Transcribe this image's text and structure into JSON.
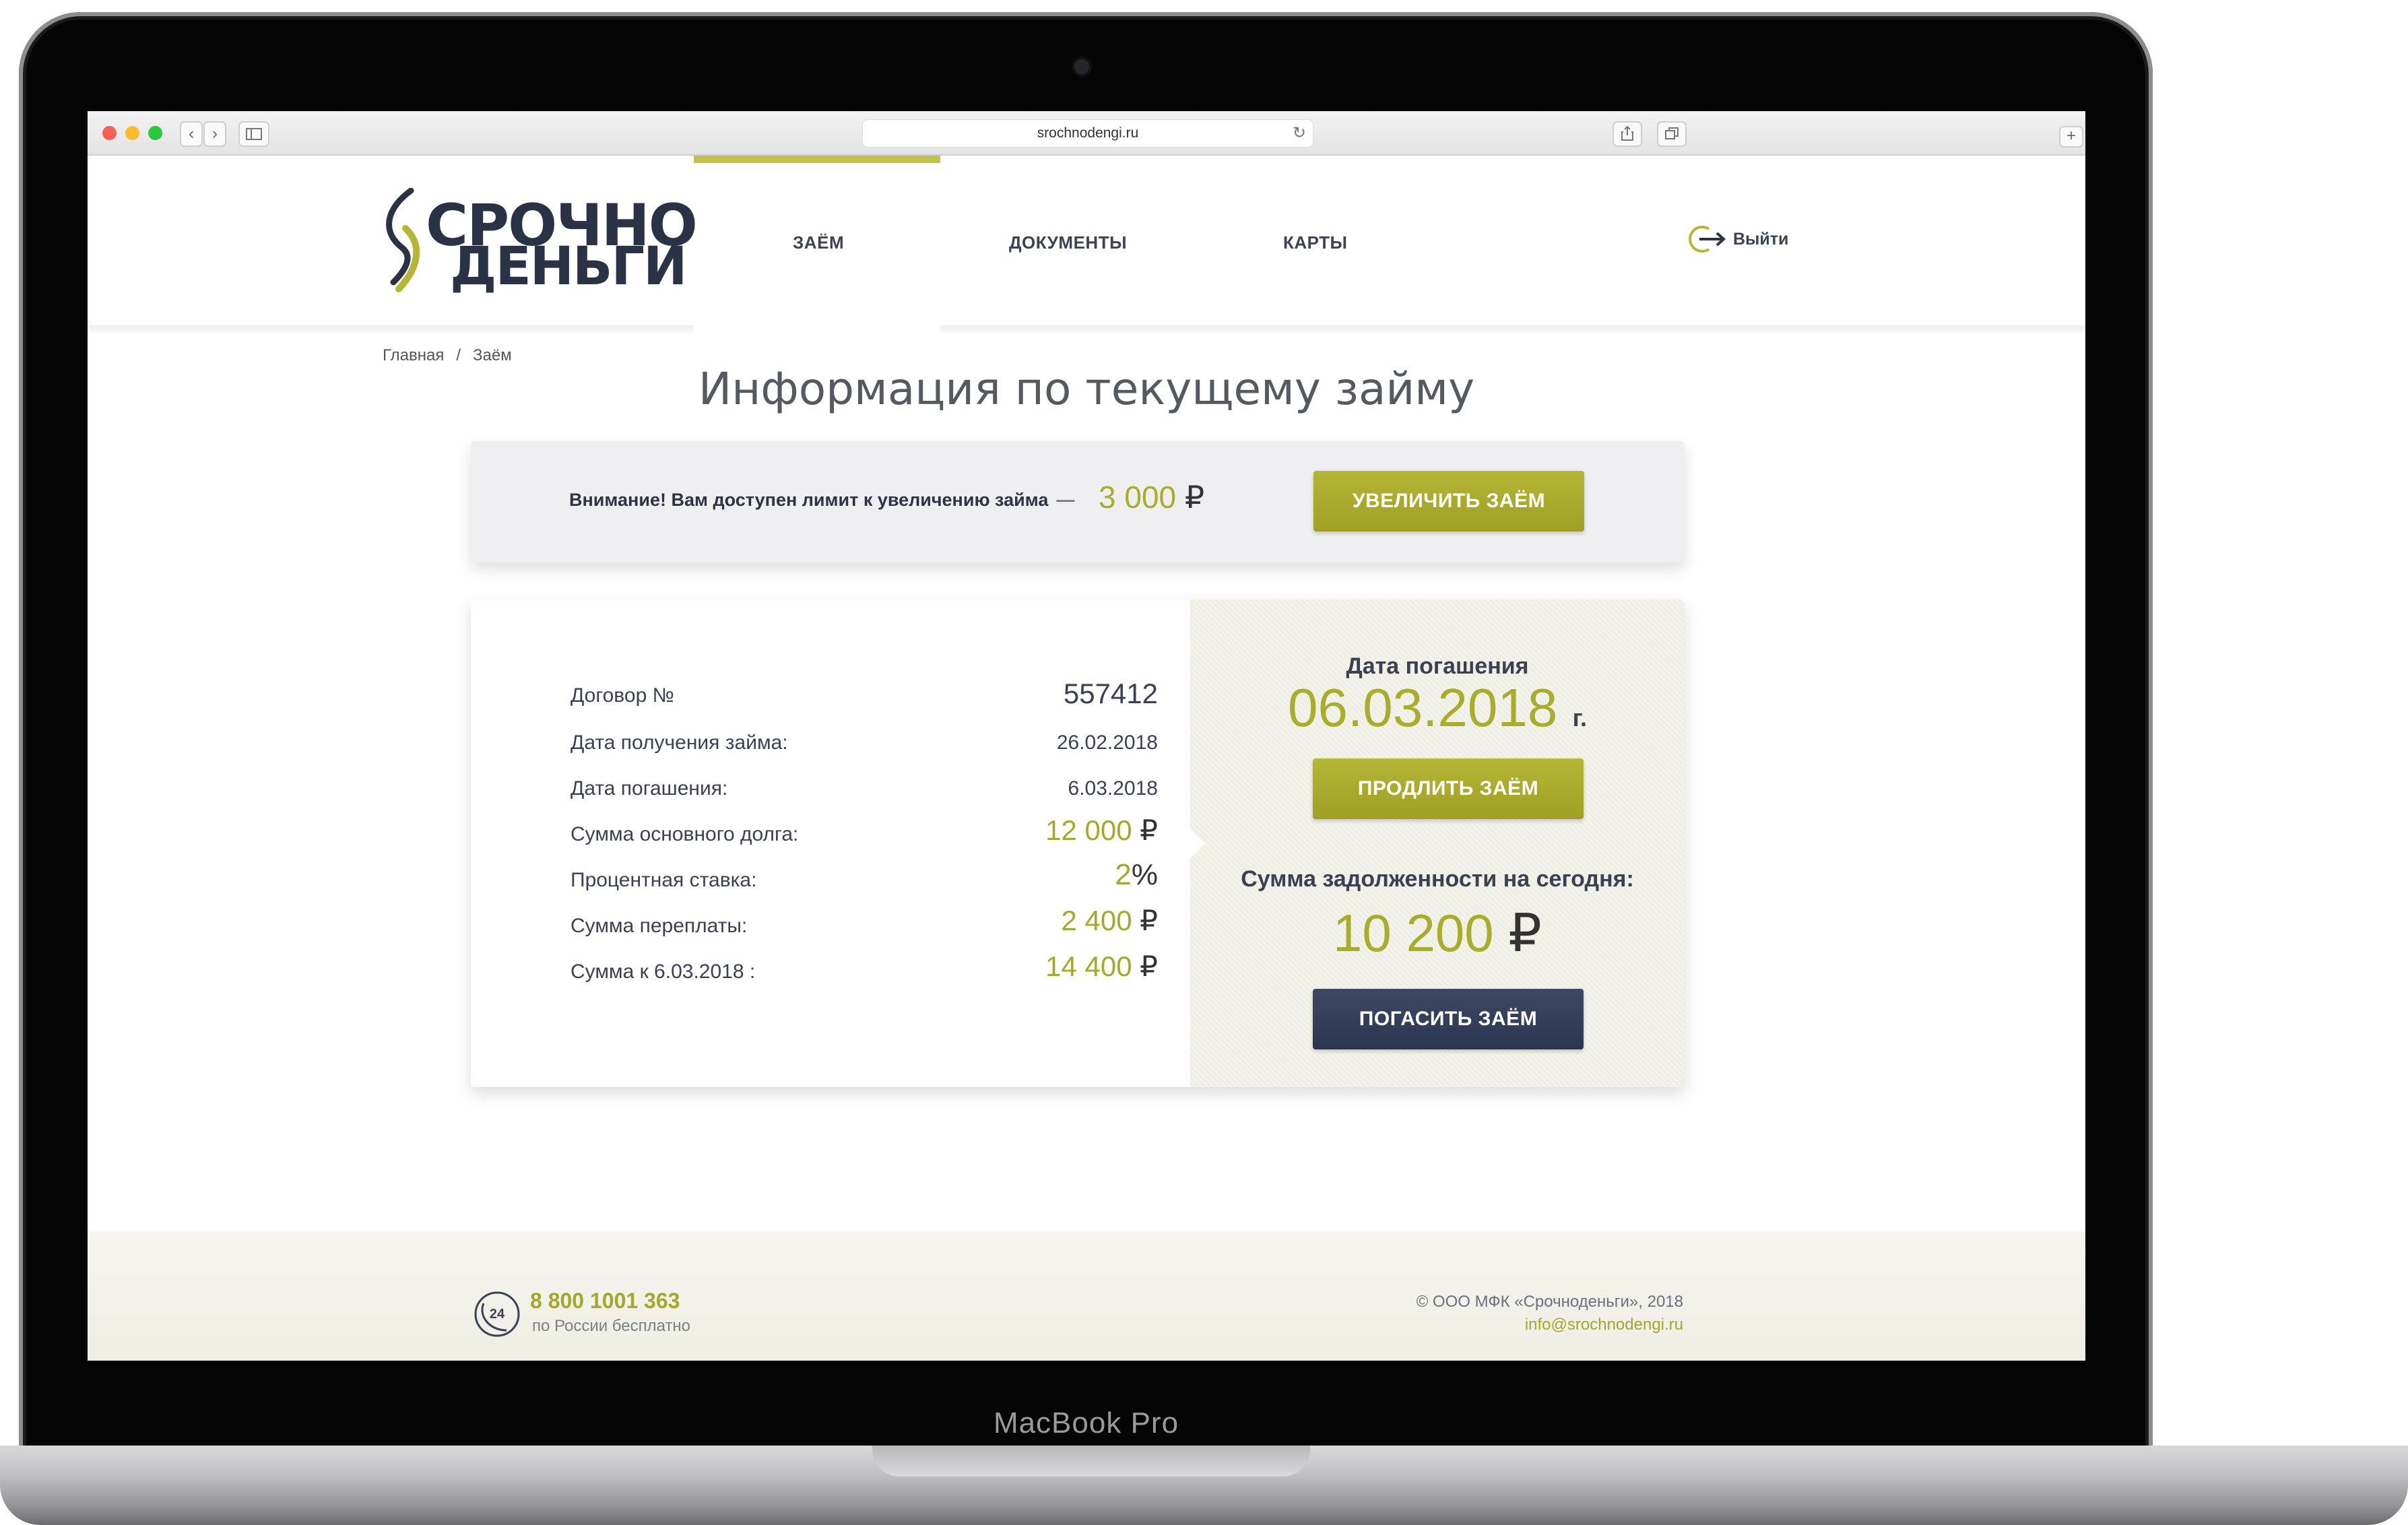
{
  "device": {
    "label": "MacBook Pro"
  },
  "browser": {
    "url": "srochnodengi.ru",
    "back": "‹",
    "forward": "›"
  },
  "logo": {
    "line1": "СРОЧНО",
    "line2": "ДЕНЬГИ"
  },
  "nav": {
    "items": [
      {
        "label": "ЗАЁМ",
        "active": true
      },
      {
        "label": "ДОКУМЕНТЫ",
        "active": false
      },
      {
        "label": "КАРТЫ",
        "active": false
      }
    ],
    "logout_label": "Выйти"
  },
  "breadcrumb": {
    "home": "Главная",
    "separator": "/",
    "current": "Заём"
  },
  "page_title": "Информация по текущему займу",
  "notice": {
    "text": "Внимание! Вам доступен лимит к увеличению займа",
    "dash": "—",
    "amount": "3 000",
    "currency": "₽",
    "button": "УВЕЛИЧИТЬ ЗАЁМ"
  },
  "loan": {
    "rows": [
      {
        "label": "Договор №",
        "value": "557412",
        "currency": ""
      },
      {
        "label": "Дата получения займа:",
        "value": "26.02.2018",
        "currency": ""
      },
      {
        "label": "Дата погашения:",
        "value": "6.03.2018",
        "currency": ""
      },
      {
        "label": "Сумма основного долга:",
        "value": "12 000",
        "currency": "₽"
      },
      {
        "label": "Процентная ставка:",
        "value": "2",
        "currency": "%"
      },
      {
        "label": "Сумма переплаты:",
        "value": "2 400",
        "currency": "₽"
      },
      {
        "label": "Сумма к 6.03.2018 :",
        "value": "14 400",
        "currency": "₽"
      }
    ]
  },
  "repayment": {
    "due_title": "Дата погашения",
    "due_date": "06.03.2018",
    "due_suffix": "г.",
    "extend_button": "ПРОДЛИТЬ ЗАЁМ",
    "debt_title": "Сумма задолженности на сегодня:",
    "debt_amount": "10 200",
    "debt_currency": "₽",
    "pay_button": "ПОГАСИТЬ ЗАЁМ"
  },
  "footer": {
    "phone": "8 800 1001 363",
    "phone_note": "по России бесплатно",
    "badge": "24",
    "copyright": "© ООО МФК «Срочноденьги», 2018",
    "email": "info@srochnodengi.ru"
  },
  "colors": {
    "accent": "#a8ad2c",
    "navy": "#2b3650",
    "text": "#3b4152"
  }
}
